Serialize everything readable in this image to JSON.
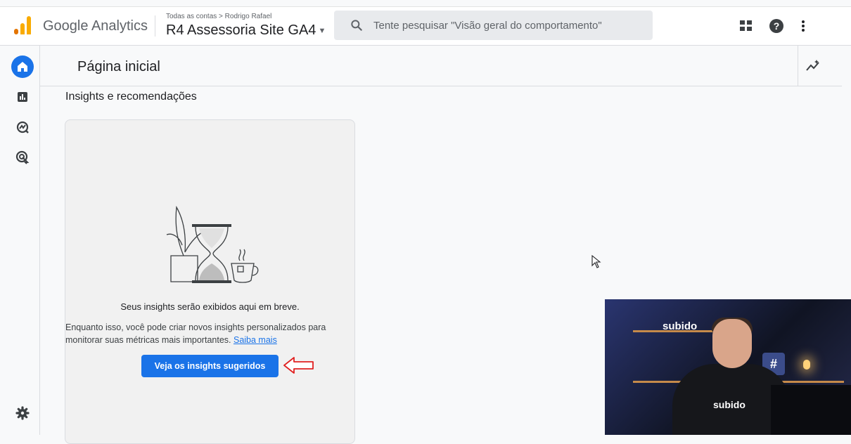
{
  "header": {
    "product_name": "Google Analytics",
    "breadcrumb": "Todas as contas > Rodrigo Rafael",
    "property_name": "R4 Assessoria Site GA4",
    "search_placeholder": "Tente pesquisar \"Visão geral do comportamento\"",
    "icons": [
      "apps-grid-icon",
      "help-icon",
      "more-vert-icon"
    ]
  },
  "sidebar": {
    "items": [
      {
        "name": "home-icon",
        "active": true
      },
      {
        "name": "reports-icon",
        "active": false
      },
      {
        "name": "explore-icon",
        "active": false
      },
      {
        "name": "advertising-icon",
        "active": false
      }
    ],
    "settings": "settings-gear-icon"
  },
  "main": {
    "page_title": "Página inicial",
    "section_title": "Insights e recomendações",
    "card": {
      "heading": "Seus insights serão exibidos aqui em breve.",
      "body": "Enquanto isso, você pode criar novos insights personalizados para monitorar suas métricas mais importantes.",
      "link": "Saiba mais",
      "button": "Veja os insights sugeridos"
    }
  },
  "overlay": {
    "video_text_shelf": "subido",
    "video_text_shirt": "subido"
  },
  "colors": {
    "accent": "#1a73e8",
    "annotation_arrow": "#e02020",
    "logo_orange": "#f9ab00",
    "logo_dark_orange": "#e37400"
  }
}
